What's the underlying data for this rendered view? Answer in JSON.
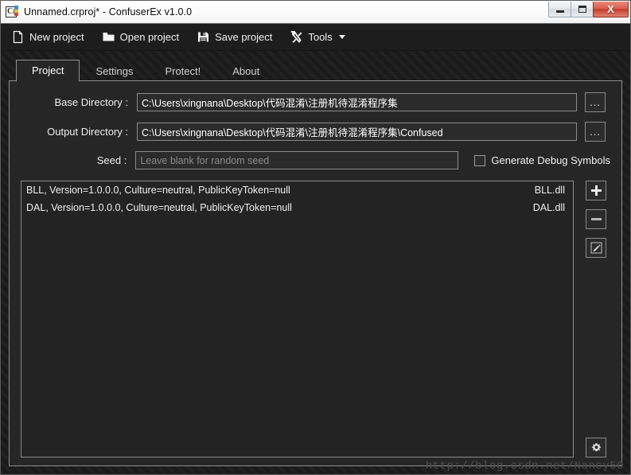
{
  "window": {
    "title": "Unnamed.crproj* - ConfuserEx v1.0.0",
    "app_icon": "confuserex-icon",
    "minimize_label": "Minimize",
    "maximize_label": "Maximize",
    "close_label": "Close",
    "close_glyph": "X"
  },
  "toolbar": {
    "items": [
      {
        "label": "New project",
        "icon": "new-document-icon"
      },
      {
        "label": "Open project",
        "icon": "open-folder-icon"
      },
      {
        "label": "Save project",
        "icon": "floppy-disk-icon"
      },
      {
        "label": "Tools",
        "icon": "tools-hammer-wrench-icon",
        "has_caret": true
      }
    ]
  },
  "tabs": [
    {
      "label": "Project",
      "active": true
    },
    {
      "label": "Settings",
      "active": false
    },
    {
      "label": "Protect!",
      "active": false
    },
    {
      "label": "About",
      "active": false
    }
  ],
  "form": {
    "base_directory": {
      "label": "Base Directory :",
      "value": "C:\\Users\\xingnana\\Desktop\\代码混淆\\注册机待混淆程序集",
      "browse_label": "...",
      "browse_icon": "ellipsis-icon"
    },
    "output_directory": {
      "label": "Output Directory :",
      "value": "C:\\Users\\xingnana\\Desktop\\代码混淆\\注册机待混淆程序集\\Confused",
      "browse_label": "...",
      "browse_icon": "ellipsis-icon"
    },
    "seed": {
      "label": "Seed :",
      "value": "",
      "placeholder": "Leave blank for random seed"
    },
    "debug_symbols": {
      "label": "Generate Debug Symbols",
      "checked": false
    }
  },
  "assembly_list": {
    "rows": [
      {
        "name": "BLL, Version=1.0.0.0, Culture=neutral, PublicKeyToken=null",
        "file": "BLL.dll"
      },
      {
        "name": "DAL, Version=1.0.0.0, Culture=neutral, PublicKeyToken=null",
        "file": "DAL.dll"
      }
    ]
  },
  "list_buttons": {
    "add": {
      "label": "+",
      "icon": "plus-icon"
    },
    "remove": {
      "label": "−",
      "icon": "minus-icon"
    },
    "edit": {
      "label": "Edit",
      "icon": "pencil-edit-icon"
    },
    "settings": {
      "label": "Settings",
      "icon": "gear-icon"
    }
  },
  "watermark": {
    "text": "http://blog.csdn.net/Nancy50"
  },
  "colors": {
    "window_bg": "#202020",
    "panel_bg": "#262626",
    "stripe_light": "#212121",
    "stripe_dark": "#1a1a1a",
    "border": "#8f8f8f",
    "text": "#efefef",
    "placeholder": "#8c8c8c",
    "close_button": "#c33f2c"
  }
}
